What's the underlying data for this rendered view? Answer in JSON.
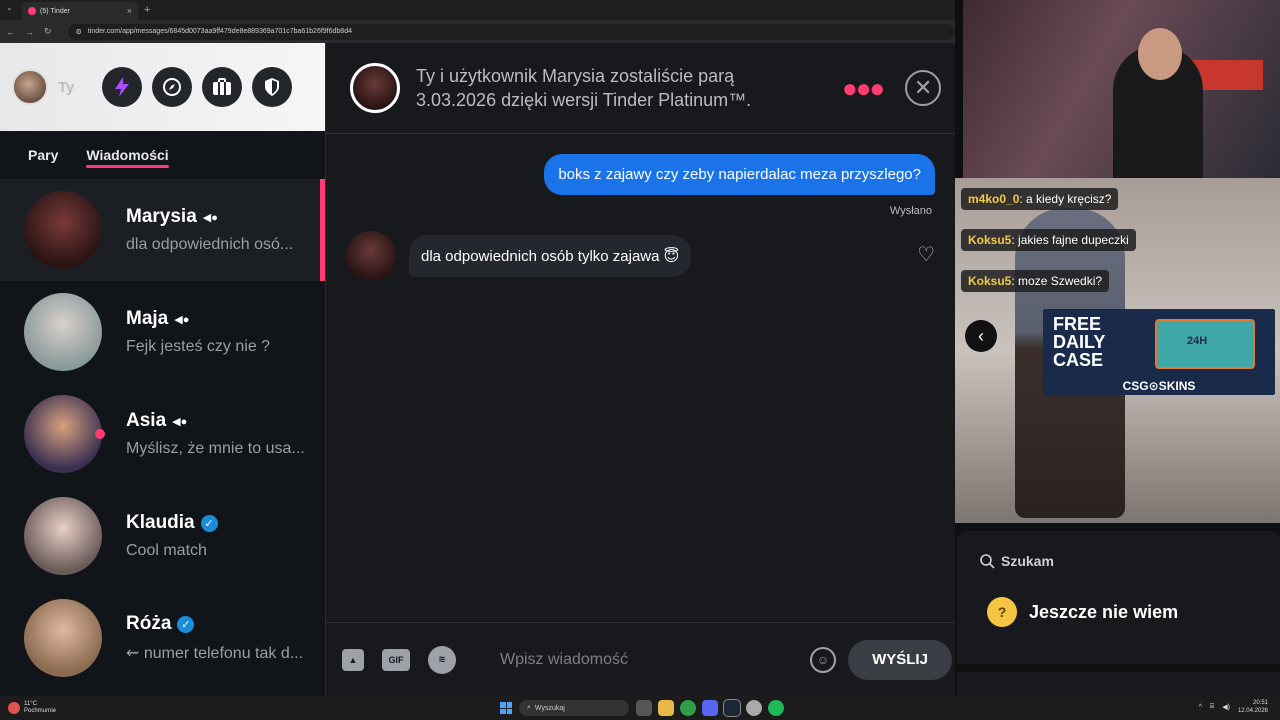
{
  "browser": {
    "tab_title": "(5) Tinder",
    "url": "tinder.com/app/messages/6845d0073aa9ff479de8e889369a701c7ba61b26f9f6db8d4",
    "new_tab_label": "+",
    "tab_close": "×"
  },
  "sidebar": {
    "me_label": "Ty",
    "tabs": {
      "matches": "Pary",
      "messages": "Wiadomości"
    },
    "conversations": [
      {
        "name": "Marysia",
        "preview": "dla odpowiednich osó...",
        "badge": "video"
      },
      {
        "name": "Maja",
        "preview": "Fejk jesteś czy nie ?",
        "badge": "video"
      },
      {
        "name": "Asia",
        "preview": "Myślisz, że mnie to usa...",
        "badge": "video"
      },
      {
        "name": "Klaudia",
        "preview": "Cool match",
        "badge": "verified"
      },
      {
        "name": "Róża",
        "preview": "⇜ numer telefonu tak d...",
        "badge": "verified"
      }
    ]
  },
  "chat": {
    "match_text": "Ty i użytkownik Marysia zostaliście parą 3.03.2026 dzięki wersji Tinder Platinum™.",
    "messages": {
      "outgoing": "boks z zajawy czy zeby napierdalac meza przyszlego?",
      "sent_status": "Wysłano",
      "incoming": "dla odpowiednich osób tylko zajawa 😇"
    },
    "composer": {
      "gif_label": "GIF",
      "placeholder": "Wpisz wiadomość",
      "send_label": "WYŚLIJ"
    }
  },
  "stream": {
    "chat_lines": [
      {
        "user": "m4ko0_0",
        "text": "a kiedy kręcisz?"
      },
      {
        "user": "Koksu5",
        "text": "jakies fajne dupeczki"
      },
      {
        "user": "Koksu5",
        "text": "moze Szwedki?"
      }
    ],
    "ad": {
      "title": "FREE DAILY CASE",
      "badge": "24H",
      "brand": "CSG⊙SKINS"
    },
    "looking_for_label": "Szukam",
    "looking_for_value": "Jeszcze nie wiem"
  },
  "taskbar": {
    "weather_temp": "11°C",
    "weather_desc": "Pochmurnie",
    "search_placeholder": "Wyszukaj",
    "time": "20:51",
    "date": "12.04.2026"
  },
  "colors": {
    "accent": "#fe3c72",
    "outgoing_bubble": "#1a73e8",
    "verified": "#1a8cd8"
  }
}
